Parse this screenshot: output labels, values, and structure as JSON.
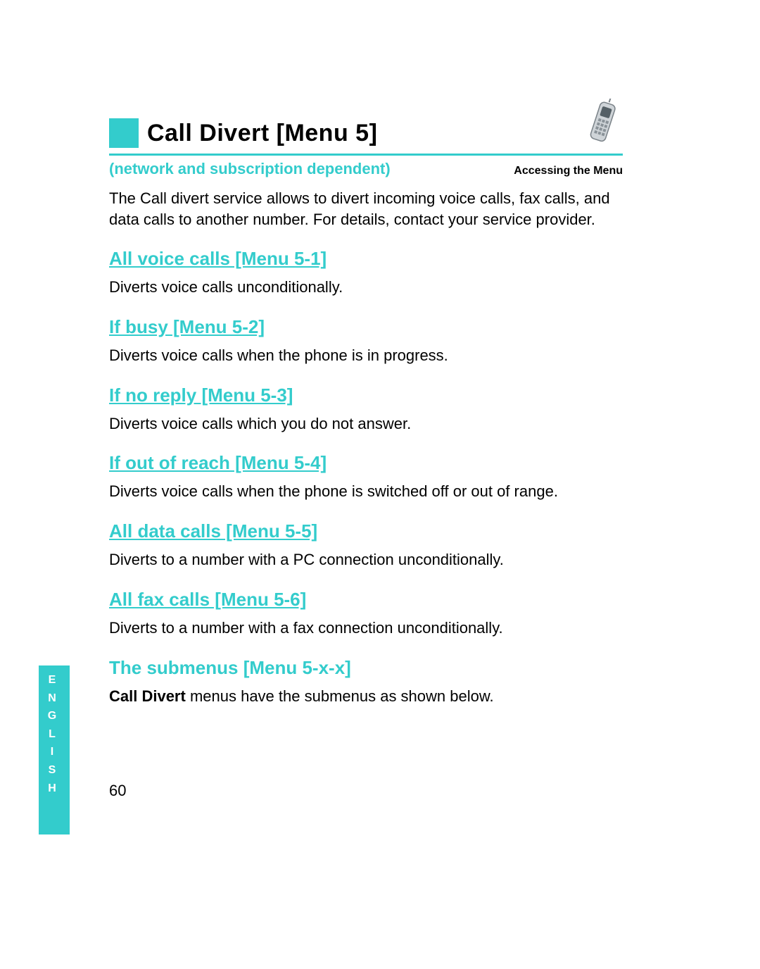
{
  "header": {
    "title": "Call Divert [Menu 5]",
    "subtitle": "(network and subscription dependent)",
    "section_label": "Accessing the Menu",
    "icon_name": "phone-icon"
  },
  "intro": "The Call divert service allows to divert incoming voice calls, fax calls, and data calls to another number. For details, contact your service provider.",
  "sections": [
    {
      "heading": "All voice calls [Menu 5-1]",
      "body": "Diverts voice calls unconditionally.",
      "underlined": true
    },
    {
      "heading": "If busy [Menu 5-2]",
      "body": "Diverts voice calls when the phone is in progress.",
      "underlined": true
    },
    {
      "heading": "If no reply [Menu 5-3]",
      "body": "Diverts voice calls which you do not answer.",
      "underlined": true
    },
    {
      "heading": "If out of reach [Menu 5-4]",
      "body": "Diverts voice calls when the phone is switched off or out of range.",
      "underlined": true
    },
    {
      "heading": "All data calls [Menu 5-5]",
      "body": "Diverts to a number with a PC connection unconditionally.",
      "underlined": true
    },
    {
      "heading": "All fax calls [Menu 5-6]",
      "body": "Diverts to a number with a fax connection unconditionally.",
      "underlined": true
    },
    {
      "heading": "The submenus [Menu 5-x-x]",
      "body_prefix_bold": "Call Divert",
      "body_rest": " menus have the submenus as shown below.",
      "underlined": false
    }
  ],
  "side_tab": "ENGLISH",
  "page_number": "60"
}
